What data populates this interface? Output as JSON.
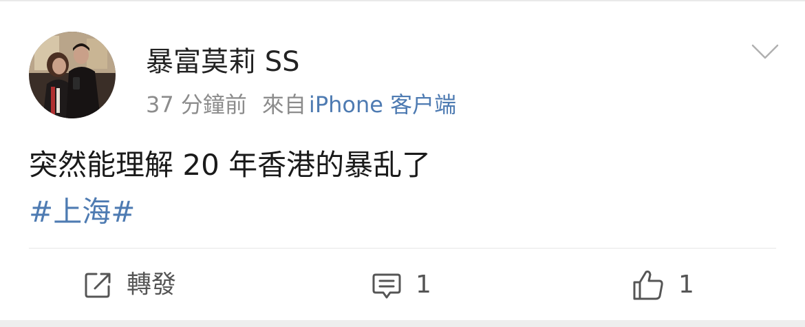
{
  "post": {
    "username": "暴富莫莉 SS",
    "time_ago": "37 分鐘前",
    "from_label": "來自",
    "source": "iPhone 客户端",
    "text": "突然能理解 20 年香港的暴乱了",
    "topic": "#上海#"
  },
  "actions": {
    "repost_label": "轉發",
    "comment_count": "1",
    "like_count": "1"
  },
  "colors": {
    "link": "#4e7bb2",
    "meta": "#8c8c8c",
    "text": "#1a1a1a",
    "icon": "#555555"
  },
  "icons": {
    "menu": "chevron-down-icon",
    "repost": "share-icon",
    "comment": "comment-icon",
    "like": "thumbs-up-icon"
  }
}
